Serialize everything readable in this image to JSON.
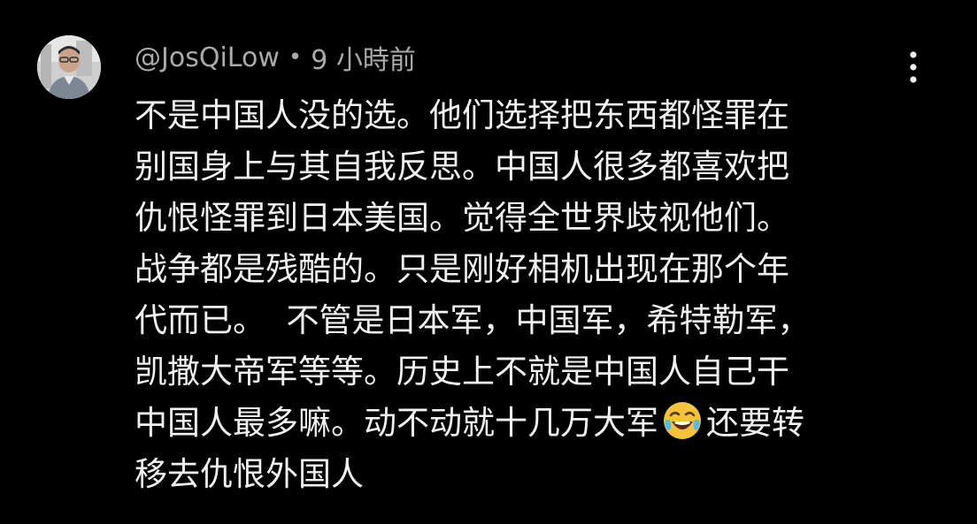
{
  "comment": {
    "author": "@JosQiLow",
    "separator": "•",
    "time": "9 小時前",
    "avatar_icon": "user-avatar-photo",
    "menu_icon": "more-vert-icon",
    "lines": [
      "不是中国人没的选。他们选择把东西都怪罪在",
      "别国身上与其自我反思。中国人很多都喜欢把",
      "仇恨怪罪到日本美国。觉得全世界歧视他们。",
      "战争都是残酷的。只是刚好相机出现在那个年",
      "代而已。  不管是日本军，中国军，希特勒军，",
      "凯撒大帝军等等。历史上不就是中国人自己干",
      "中国人最多嘛。动不动就十几万大军",
      "移去仇恨外国人"
    ],
    "line7_after_emoji": "还要转",
    "emoji_name": "face-with-tears-of-joy-emoji"
  },
  "colors": {
    "background": "#000000",
    "text": "#f1f1f1",
    "meta": "#aaaaaa",
    "emoji_face": "#f5c33b"
  }
}
